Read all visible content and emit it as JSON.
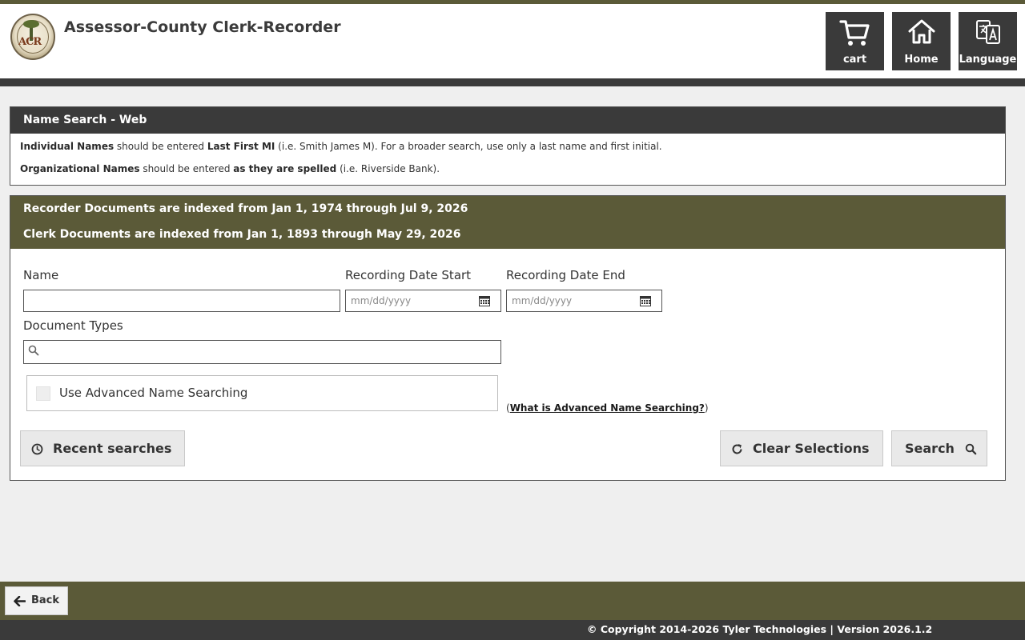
{
  "header": {
    "logo_alt": "ACR",
    "title": "Assessor-County Clerk-Recorder",
    "buttons": {
      "cart": "cart",
      "home": "Home",
      "language": "Language"
    }
  },
  "info_panel": {
    "title": "Name Search - Web",
    "individual": {
      "bold1": "Individual Names",
      "text1": " should be entered ",
      "bold2": "Last First MI",
      "text2": " (i.e. Smith James M). For a broader search, use only a last name and first initial."
    },
    "organizational": {
      "bold1": "Organizational Names",
      "text1": " should be entered ",
      "bold2": "as they are spelled",
      "text2": " (i.e. Riverside Bank)."
    }
  },
  "index_info": {
    "recorder": "Recorder Documents are indexed from Jan 1, 1974 through Jul 9, 2026",
    "clerk": "Clerk Documents are indexed from Jan 1, 1893 through May 29, 2026"
  },
  "form": {
    "name_label": "Name",
    "name_value": "",
    "date_start_label": "Recording Date Start",
    "date_start_placeholder": "mm/dd/yyyy",
    "date_end_label": "Recording Date End",
    "date_end_placeholder": "mm/dd/yyyy",
    "doc_types_label": "Document Types",
    "doc_types_value": "",
    "advanced_label": "Use Advanced Name Searching",
    "advanced_checked": false,
    "advanced_help_prefix": "(",
    "advanced_help_link": "What is Advanced Name Searching?",
    "advanced_help_suffix": ")"
  },
  "actions": {
    "recent": "Recent searches",
    "clear": "Clear Selections",
    "search": "Search"
  },
  "footer": {
    "back": "Back",
    "copyright": "© Copyright 2014-2026 Tyler Technologies | Version 2026.1.2"
  },
  "colors": {
    "olive": "#5b5a38",
    "dark": "#3a3a3a",
    "background": "#efefef"
  }
}
